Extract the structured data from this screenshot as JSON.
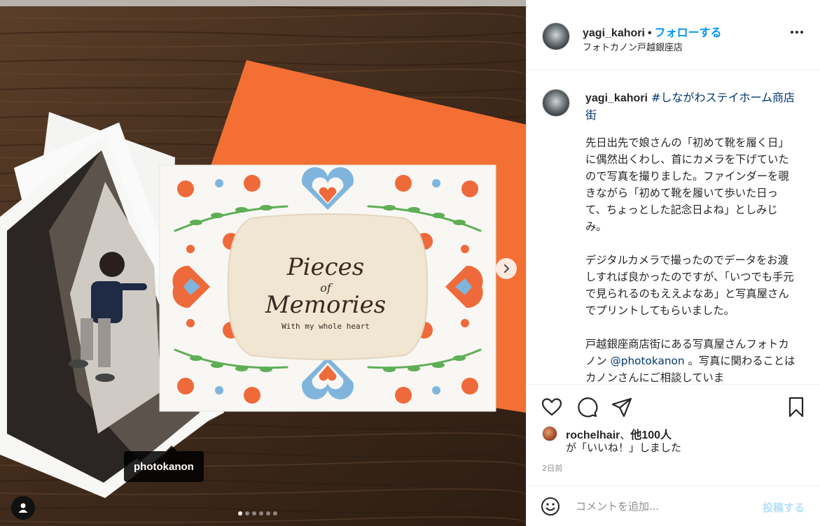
{
  "post": {
    "username": "yagi_kahori",
    "separator": "•",
    "follow_label": "フォローする",
    "location": "フォトカノン戸越銀座店"
  },
  "media": {
    "card_title_line1": "Pieces",
    "card_title_of": "of",
    "card_title_line2": "Memories",
    "card_subtitle": "With my whole heart",
    "tag_label": "photokanon",
    "carousel_total": 6,
    "carousel_active": 1
  },
  "caption": {
    "username": "yagi_kahori",
    "hashtag": "#しながわステイホーム商店街",
    "para1": "先日出先で娘さんの「初めて靴を履く日」に偶然出くわし、首にカメラを下げていたので写真を撮りました。ファインダーを覗きながら「初めて靴を履いて歩いた日って、ちょっとした記念日よね」としみじみ。",
    "para2": "デジタルカメラで撮ったのでデータをお渡しすれば良かったのですが、「いつでも手元で見られるのもええよなあ」と写真屋さんでプリントしてもらいました。",
    "para3_before": "戸越銀座商店街にある写真屋さんフォトカノン ",
    "para3_mention": "@photokanon",
    "para3_after": " 。写真に関わることはカノンさんにご相談していま"
  },
  "likes": {
    "liker": "rochelhair",
    "separator": "、",
    "others": "他100人",
    "line2": "が「いいね！」しました"
  },
  "timestamp": "2日前",
  "comment": {
    "placeholder": "コメントを追加...",
    "post_label": "投稿する"
  },
  "colors": {
    "follow_blue": "#0095f6",
    "link_dark_blue": "#00376b",
    "post_disabled": "#b2dffc",
    "envelope_orange": "#f36f34",
    "card_orange": "#ef6a3a",
    "card_blue": "#7fb5dc",
    "card_green": "#5fae57"
  },
  "icons": [
    "heart-icon",
    "comment-icon",
    "share-icon",
    "bookmark-icon",
    "more-icon",
    "chevron-right-icon",
    "user-tag-icon",
    "emoji-icon"
  ]
}
